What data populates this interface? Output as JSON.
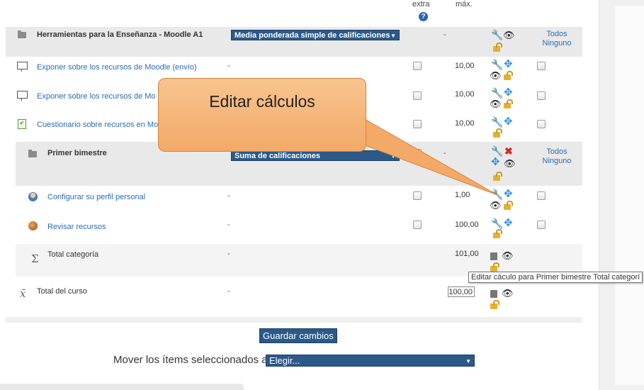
{
  "header": {
    "extra": "extra",
    "max": "máx.",
    "help_symbol": "?"
  },
  "category_main": {
    "name": "Herramientas para la Enseñanza - Moodle A1",
    "aggregation": "Media ponderada simple de calificaciones",
    "value": "-",
    "all": "Todos",
    "none": "Ninguno"
  },
  "items": [
    {
      "name": "Exponer sobre los recursos de Moodle (envío)",
      "dash": "-",
      "max": "10,00"
    },
    {
      "name": "Exponer sobre los recursos de Mo",
      "max": "10,00"
    },
    {
      "name": "Cuestionario sobre recursos en Mo",
      "max": "10,00"
    }
  ],
  "subcategory": {
    "name": "Primer bimestre",
    "aggregation": "Suma de calificaciones",
    "value": "-",
    "all": "Todos",
    "none": "Ninguno"
  },
  "sub_items": [
    {
      "name": "Configurar su perfil personal",
      "dash": "-",
      "max": "1,00"
    },
    {
      "name": "Revisar recursos",
      "dash": "-",
      "max": "100,00"
    }
  ],
  "category_total": {
    "name": "Total categoría",
    "dash": "-",
    "max": "101,00"
  },
  "course_total": {
    "name": "Total del curso",
    "dash": "-",
    "max": "100,00"
  },
  "callout": {
    "text": "Editar cálculos"
  },
  "tooltip": {
    "text": "Editar cáculo para Primer bimestre   Total categorí"
  },
  "save_button": "Guardar cambios",
  "move": {
    "label": "Mover los ítems seleccionados a",
    "select": "Elegir..."
  },
  "colors": {
    "accent": "#2b5a89",
    "link": "#2a6bb5",
    "callout": "#f3a968",
    "delete": "#d42a1f"
  }
}
